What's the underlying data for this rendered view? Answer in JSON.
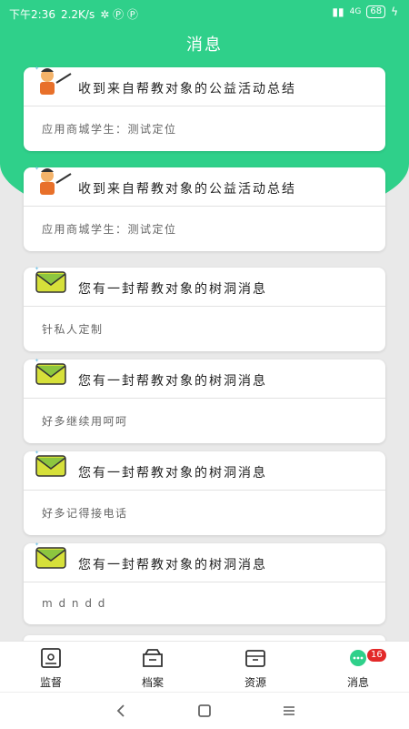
{
  "status": {
    "time": "下午2:36",
    "net": "2.2K/s",
    "right_text": "4G",
    "battery": "68"
  },
  "header": {
    "title": "消息"
  },
  "messages": [
    {
      "icon": "teacher-icon",
      "title": "收到来自帮教对象的公益活动总结",
      "body": "应用商城学生：测试定位"
    },
    {
      "icon": "teacher-icon",
      "title": "收到来自帮教对象的公益活动总结",
      "body": "应用商城学生：测试定位"
    },
    {
      "icon": "envelope-icon",
      "title": "您有一封帮教对象的树洞消息",
      "body": "针私人定制"
    },
    {
      "icon": "envelope-icon",
      "title": "您有一封帮教对象的树洞消息",
      "body": "好多继续用呵呵"
    },
    {
      "icon": "envelope-icon",
      "title": "您有一封帮教对象的树洞消息",
      "body": "好多记得接电话"
    },
    {
      "icon": "envelope-icon",
      "title": "您有一封帮教对象的树洞消息",
      "body": "m d n d d"
    }
  ],
  "tabs": [
    {
      "label": "监督",
      "icon": "monitor-icon"
    },
    {
      "label": "档案",
      "icon": "archive-icon"
    },
    {
      "label": "资源",
      "icon": "box-icon"
    },
    {
      "label": "消息",
      "icon": "chat-icon",
      "badge": "16"
    }
  ],
  "colors": {
    "accent": "#2fd08a",
    "badge": "#e32929"
  }
}
